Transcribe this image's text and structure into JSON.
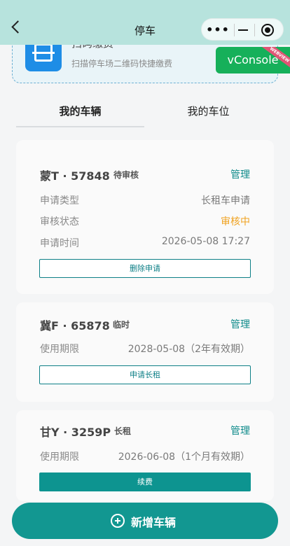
{
  "nav": {
    "title": "停车",
    "menu_dots": "•••"
  },
  "scan": {
    "title": "扫码缴费",
    "subtitle": "扫描停车场二维码快捷缴费"
  },
  "vconsole": {
    "label": "vConsole",
    "ribbon": "WEBVIEW"
  },
  "tabs": [
    {
      "label": "我的车辆",
      "active": true
    },
    {
      "label": "我的车位",
      "active": false
    }
  ],
  "vehicles": [
    {
      "plate": "蒙T · 57848",
      "tag": "待审核",
      "manage": "管理",
      "rows": [
        {
          "label": "申请类型",
          "value": "长租车申请"
        },
        {
          "label": "审核状态",
          "value": "审核中"
        },
        {
          "label": "申请时间",
          "value": "2026-05-08 17:27"
        }
      ],
      "button": "删除申请"
    },
    {
      "plate": "冀F · 65878",
      "tag": "临时",
      "manage": "管理",
      "rows": [
        {
          "label": "使用期限",
          "value": "2028-05-08（2年有效期）"
        }
      ],
      "button": "申请长租"
    },
    {
      "plate": "甘Y · 3259P",
      "tag": "长租",
      "manage": "管理",
      "rows": [
        {
          "label": "使用期限",
          "value": "2026-06-08（1个月有效期）"
        }
      ],
      "button": "续费"
    }
  ],
  "add_button": "新增车辆",
  "colors": {
    "accent": "#0d9490",
    "status_pending": "#f0a322",
    "navbar": "#b7e3dd",
    "vconsole": "#16b05a"
  }
}
